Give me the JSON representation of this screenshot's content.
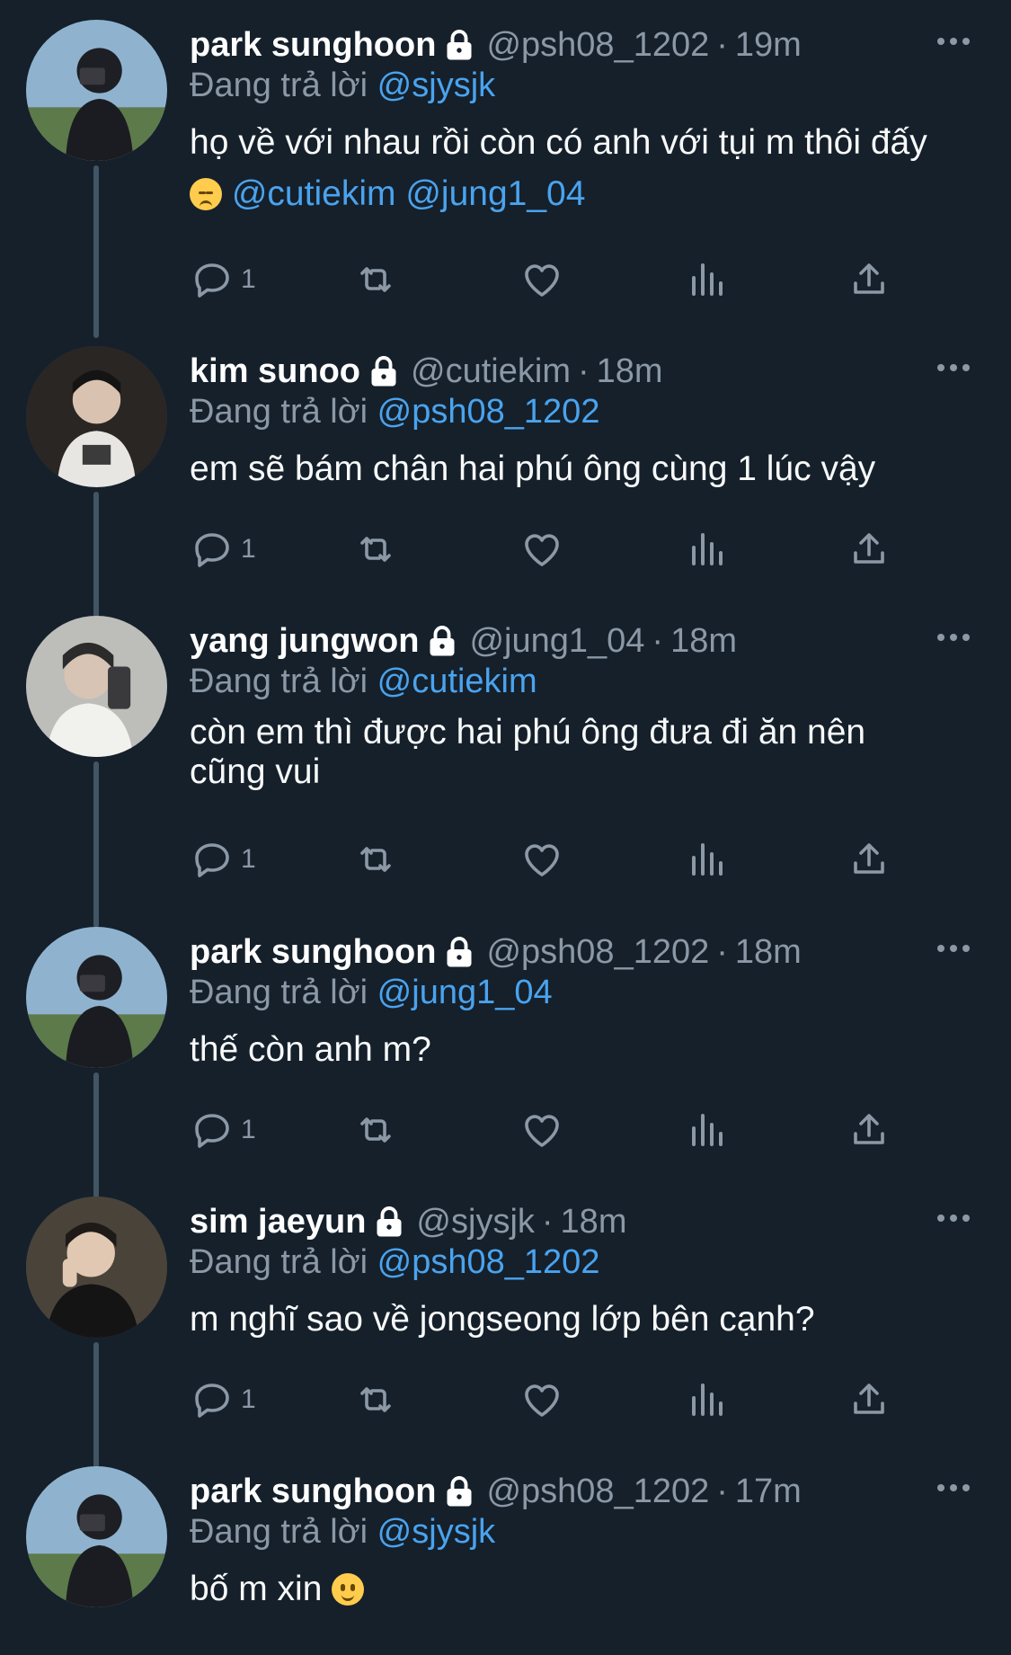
{
  "reply_prefix": "Đang trả lời",
  "colors": {
    "background": "#15202b",
    "mention": "#4aa3ee",
    "muted": "#8b98a5",
    "thread_line": "#425565"
  },
  "tweets": [
    {
      "name": "park sunghoon",
      "handle": "@psh08_1202",
      "time": "19m",
      "reply_to": "@sjysjk",
      "text_lines": [
        "họ về với nhau rồi còn có anh với tụi m thôi đấy"
      ],
      "emoji": "pensive-face",
      "mentions": [
        "@cutiekim",
        "@jung1_04"
      ],
      "reply_count": "1"
    },
    {
      "name": "kim sunoo",
      "handle": "@cutiekim",
      "time": "18m",
      "reply_to": "@psh08_1202",
      "text_lines": [
        "em sẽ bám chân hai phú ông cùng 1 lúc vậy"
      ],
      "reply_count": "1"
    },
    {
      "name": "yang jungwon",
      "handle": "@jung1_04",
      "time": "18m",
      "reply_to": "@cutiekim",
      "text_lines": [
        "còn em thì được hai phú ông đưa đi ăn nên",
        "cũng vui"
      ],
      "reply_count": "1"
    },
    {
      "name": "park sunghoon",
      "handle": "@psh08_1202",
      "time": "18m",
      "reply_to": "@jung1_04",
      "text_lines": [
        "thế còn anh m?"
      ],
      "reply_count": "1"
    },
    {
      "name": "sim jaeyun",
      "handle": "@sjysjk",
      "time": "18m",
      "reply_to": "@psh08_1202",
      "text_lines": [
        "m nghĩ sao về jongseong lớp bên cạnh?"
      ],
      "reply_count": "1"
    },
    {
      "name": "park sunghoon",
      "handle": "@psh08_1202",
      "time": "17m",
      "reply_to": "@sjysjk",
      "text_lines": [
        "bố m xin"
      ],
      "emoji": "slightly-smiling-face"
    }
  ]
}
